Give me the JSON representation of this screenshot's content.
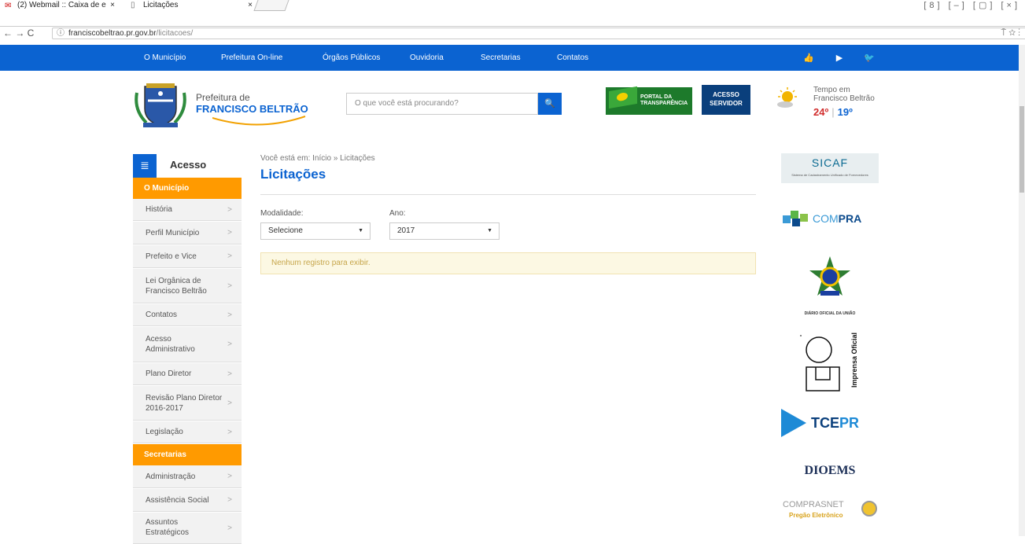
{
  "browser": {
    "tabs": [
      {
        "label": "(2) Webmail :: Caixa de e",
        "close": "×"
      },
      {
        "label": "Licitações",
        "close": "×"
      }
    ],
    "window_controls": "[8] [–] [▢] [×]",
    "nav_arrows": "← → C",
    "url_host": "franciscobeltrao.pr.gov.br",
    "url_path": "/licitacoes/",
    "addr_right_icons": "⍑ ☆ ⋮"
  },
  "topnav": {
    "items": [
      "O Município",
      "Prefeitura On-line",
      "Órgãos Públicos",
      "Ouvidoria",
      "Secretarias",
      "Contatos"
    ],
    "social_icons": [
      "thumbs-up-icon",
      "youtube-icon",
      "twitter-icon"
    ]
  },
  "header": {
    "brand_line1": "Prefeitura de",
    "brand_line2": "FRANCISCO BELTRÃO",
    "search_placeholder": "O que você está procurando?",
    "portal_line1": "PORTAL DA",
    "portal_line2": "TRANSPARÊNCIA",
    "acesso_line1": "ACESSO",
    "acesso_line2": "SERVIDOR",
    "weather_label1": "Tempo em",
    "weather_label2": "Francisco Beltrão",
    "temp_high": "24º",
    "temp_low": "19º"
  },
  "sidebar": {
    "title": "Acesso",
    "section1": "O Município",
    "items1": [
      "História",
      "Perfil Município",
      "Prefeito e Vice",
      "Lei Orgânica de Francisco Beltrão",
      "Contatos",
      "Acesso Administrativo",
      "Plano Diretor",
      "Revisão Plano Diretor 2016-2017",
      "Legislação"
    ],
    "section2": "Secretarias",
    "items2": [
      "Administração",
      "Assistência Social",
      "Assuntos Estratégicos"
    ]
  },
  "main": {
    "breadcrumb": "Você está em: Início » Licitações",
    "title": "Licitações",
    "modalidade_label": "Modalidade:",
    "modalidade_value": "Selecione",
    "ano_label": "Ano:",
    "ano_value": "2017",
    "notice": "Nenhum registro para exibir."
  },
  "right_logos": {
    "sicaf": "SICAF",
    "sicaf_sub": "Sistema de Cadastramento Unificado de Fornecedores",
    "compra1": "COM",
    "compra2": "PRA",
    "dou": "DIÁRIO OFICIAL DA UNIÃO",
    "imprensa": "Imprensa Oficial",
    "tce1": "TCE",
    "tce2": "PR",
    "dioems": "DIOEMS",
    "comprasnet1": "COMPRASNET",
    "comprasnet2": "Pregão Eletrônico"
  }
}
